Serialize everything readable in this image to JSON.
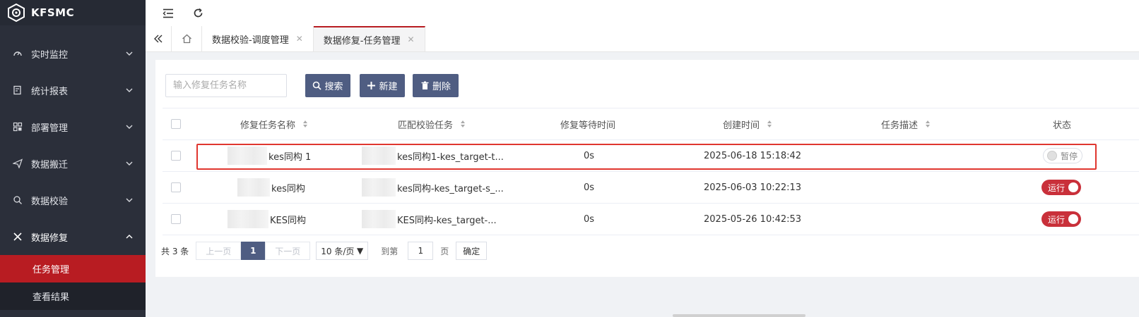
{
  "app": {
    "name": "KFSMC"
  },
  "sidebar": {
    "items": [
      {
        "label": "实时监控",
        "icon": "gauge-icon",
        "expanded": false
      },
      {
        "label": "统计报表",
        "icon": "report-icon",
        "expanded": false
      },
      {
        "label": "部署管理",
        "icon": "grid-icon",
        "expanded": false
      },
      {
        "label": "数据搬迁",
        "icon": "send-icon",
        "expanded": false
      },
      {
        "label": "数据校验",
        "icon": "magnifier-icon",
        "expanded": false
      },
      {
        "label": "数据修复",
        "icon": "tools-icon",
        "expanded": true
      }
    ],
    "submenu": [
      {
        "label": "任务管理",
        "active": true
      },
      {
        "label": "查看结果",
        "active": false
      }
    ]
  },
  "tabs": [
    {
      "label": "数据校验-调度管理",
      "active": false
    },
    {
      "label": "数据修复-任务管理",
      "active": true
    }
  ],
  "toolbar": {
    "search_placeholder": "输入修复任务名称",
    "search_label": "搜索",
    "new_label": "新建",
    "delete_label": "删除"
  },
  "table": {
    "columns": [
      "修复任务名称",
      "匹配校验任务",
      "修复等待时间",
      "创建时间",
      "任务描述",
      "状态"
    ],
    "rows": [
      {
        "name": "kes同构 1",
        "match": "kes同构1-kes_target-t...",
        "wait": "0s",
        "created": "2025-06-18 15:18:42",
        "desc": "",
        "status": "暂停",
        "running": false,
        "highlighted": true
      },
      {
        "name": "kes同构",
        "match": "kes同构-kes_target-s_...",
        "wait": "0s",
        "created": "2025-06-03 10:22:13",
        "desc": "",
        "status": "运行",
        "running": true,
        "highlighted": false
      },
      {
        "name": "KES同构",
        "match": "KES同构-kes_target-...",
        "wait": "0s",
        "created": "2025-05-26 10:42:53",
        "desc": "",
        "status": "运行",
        "running": true,
        "highlighted": false
      }
    ]
  },
  "pager": {
    "total": "共 3 条",
    "prev": "上一页",
    "current": "1",
    "next": "下一页",
    "page_size": "10 条/页",
    "goto_label": "到第",
    "goto_value": "1",
    "unit": "页",
    "confirm": "确定"
  },
  "colors": {
    "sidebar_bg": "#2b2f3a",
    "accent_red": "#b81c22",
    "button_bg": "#4f5d82",
    "running_red": "#c9303a"
  }
}
